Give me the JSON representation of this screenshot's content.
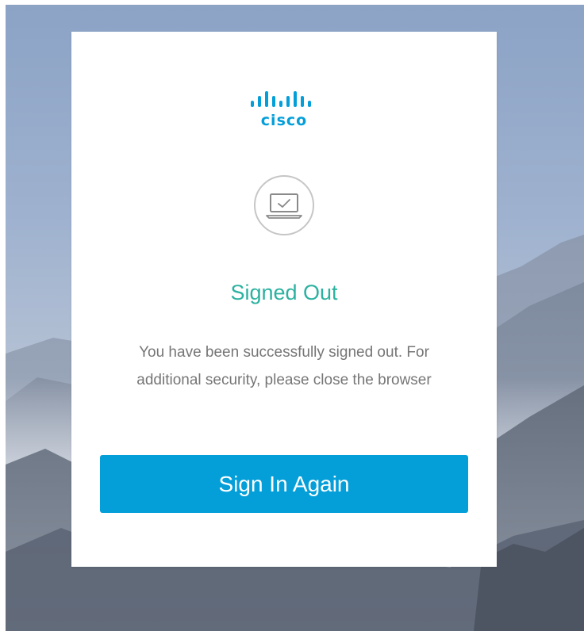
{
  "brand": {
    "name": "cisco",
    "logo_icon": "cisco-bridge-bars",
    "color": "#049fd9"
  },
  "status_icon": "laptop-check-icon",
  "title": "Signed Out",
  "message": "You have been successfully signed out. For additional security, please close the browser",
  "primary_action": {
    "label": "Sign In Again",
    "color": "#049fd9"
  },
  "colors": {
    "title": "#2bb1a0",
    "body_text": "#767676",
    "card": "#ffffff",
    "sky": "#8fa6c8"
  }
}
